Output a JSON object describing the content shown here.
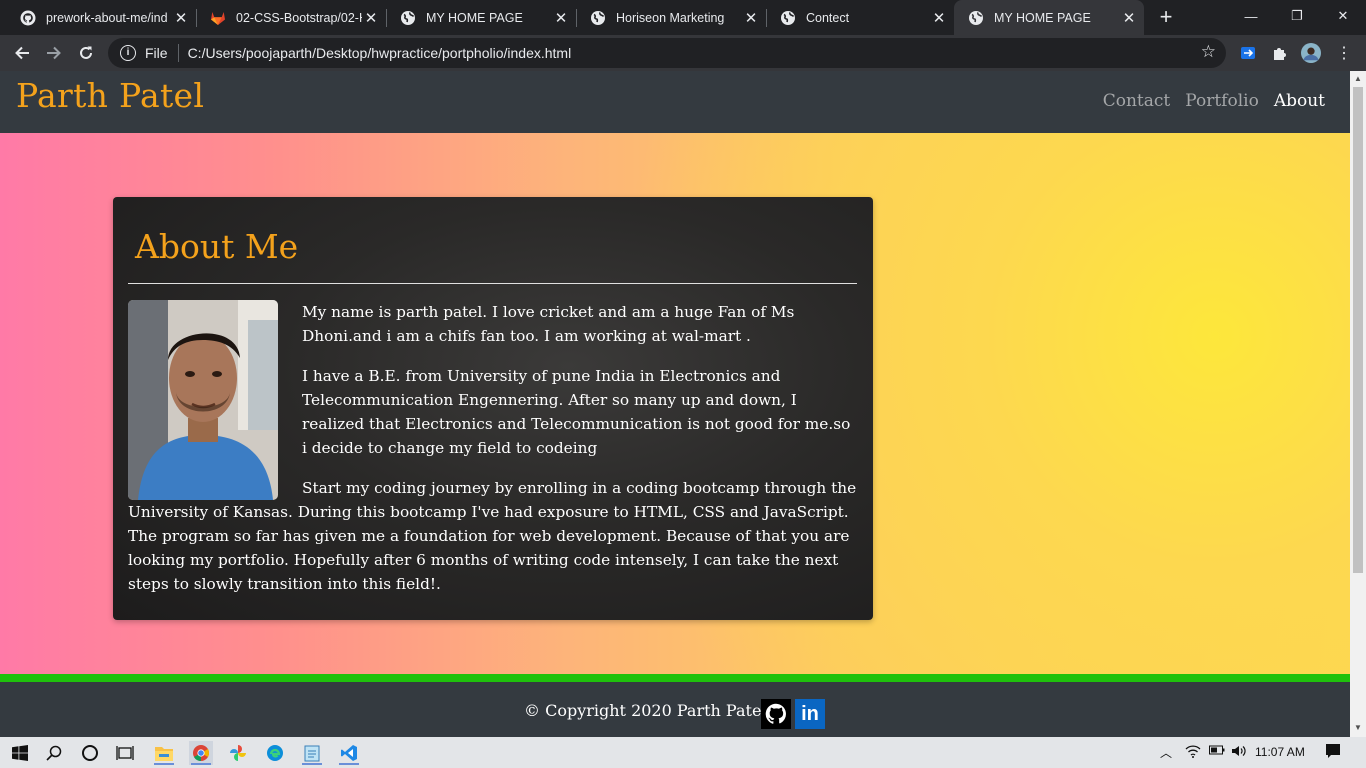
{
  "browser": {
    "tabs": [
      {
        "title": "prework-about-me/ind",
        "icon": "github-icon",
        "active": false
      },
      {
        "title": "02-CSS-Bootstrap/02-H",
        "icon": "gitlab-icon",
        "active": false
      },
      {
        "title": "MY HOME PAGE",
        "icon": "globe-icon",
        "active": false
      },
      {
        "title": "Horiseon Marketing",
        "icon": "globe-icon",
        "active": false
      },
      {
        "title": "Contect",
        "icon": "globe-icon",
        "active": false
      },
      {
        "title": "MY HOME PAGE",
        "icon": "globe-icon",
        "active": true
      }
    ],
    "address": {
      "scheme_label": "File",
      "url": "C:/Users/poojaparth/Desktop/hwpractice/portpholio/index.html"
    }
  },
  "site": {
    "brand": "Parth Patel",
    "nav": [
      {
        "label": "Contact",
        "active": false
      },
      {
        "label": "Portfolio",
        "active": false
      },
      {
        "label": "About",
        "active": true
      }
    ],
    "about": {
      "heading": "About Me",
      "paragraphs": [
        "My name is parth patel. I love cricket and am a huge Fan of Ms Dhoni.and i am a chifs fan too. I am working at wal-mart .",
        "I have a B.E. from University of pune India in Electronics and Telecommunication Engennering. After so many up and down, I realized that Electronics and Telecommunication is not good for me.so i decide to change my field to codeing",
        "Start my coding journey by enrolling in a coding bootcamp through the University of Kansas. During this bootcamp I've had exposure to HTML, CSS and JavaScript. The program so far has given me a foundation for web development. Because of that you are looking my portfolio. Hopefully after 6 months of writing code intensely, I can take the next steps to slowly transition into this field!."
      ]
    },
    "footer": {
      "copyright": "© Copyright 2020 Parth Patel",
      "linkedin_label": "in"
    }
  },
  "taskbar": {
    "clock": "11:07 AM"
  },
  "colors": {
    "brand_orange": "#f4a21c",
    "header_bg": "#343a40",
    "footer_accent": "#1fc10c",
    "linkedin_blue": "#0a66c2"
  }
}
